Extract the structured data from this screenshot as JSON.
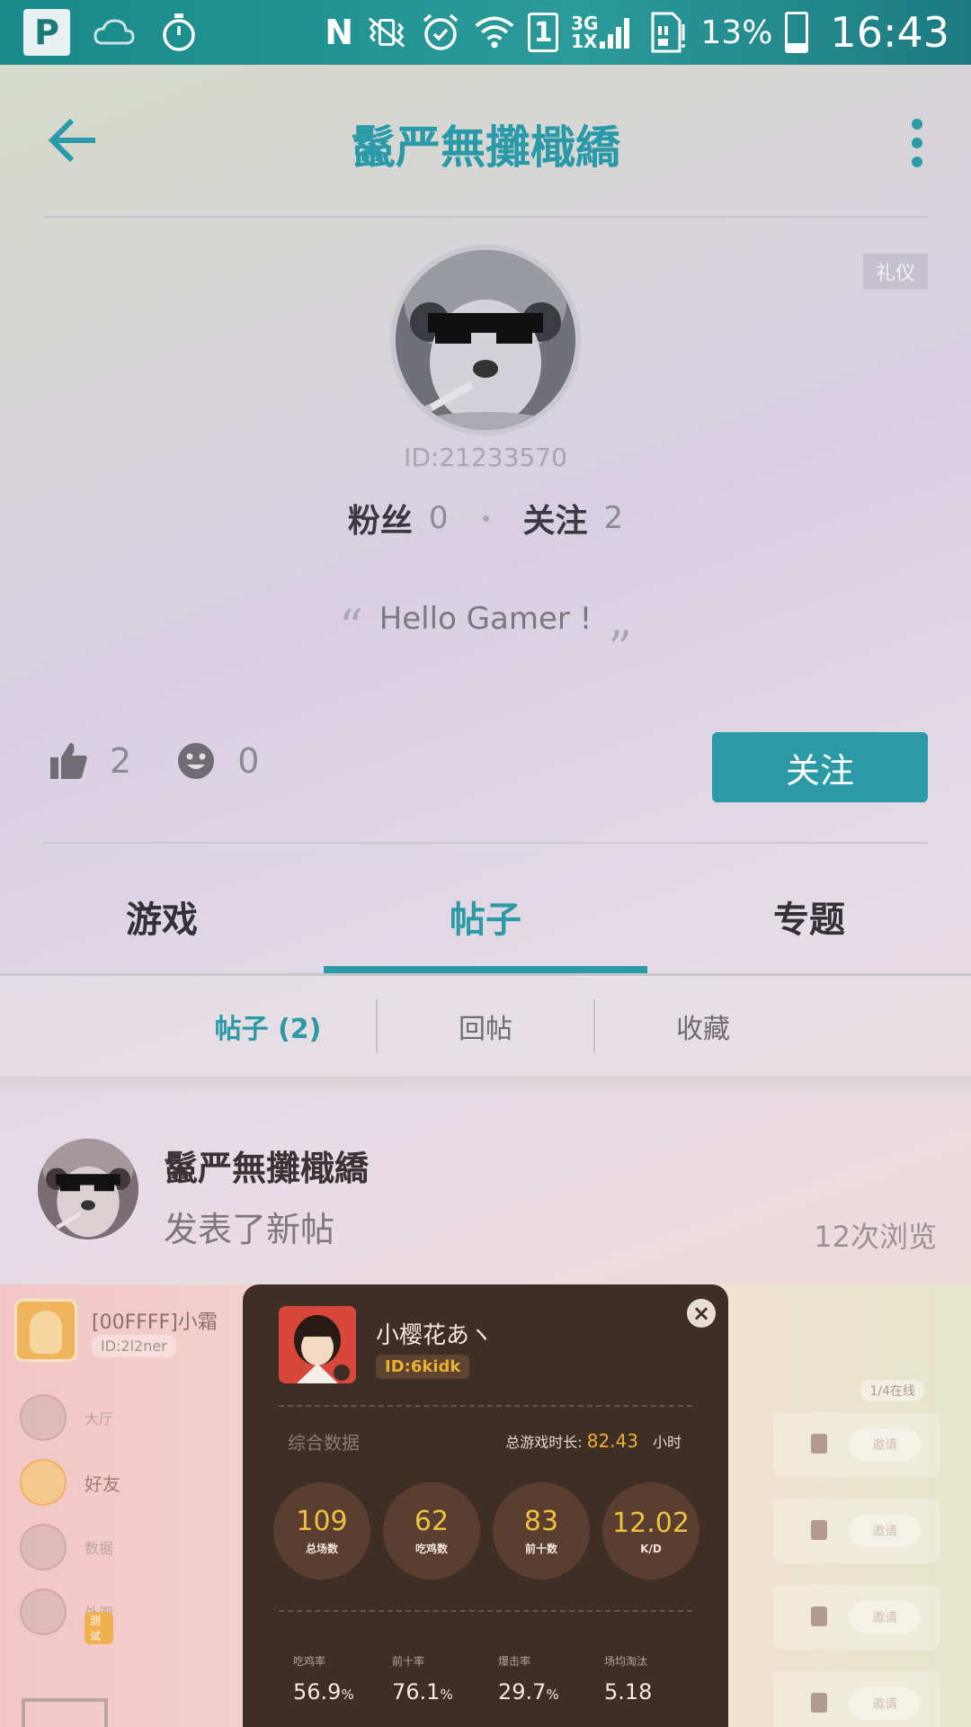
{
  "status_bar": {
    "app_icon_letter": "P",
    "nfc": "N",
    "sim": "1",
    "network_top": "3G",
    "network_bottom": "1X",
    "battery_percent": "13%",
    "time": "16:43"
  },
  "header": {
    "title": "鬣严無攤檝繑"
  },
  "profile": {
    "badge": "礼仪",
    "user_id": "ID:21233570",
    "followers_label": "粉丝",
    "followers_count": "0",
    "following_label": "关注",
    "following_count": "2",
    "motto": "Hello Gamer !",
    "likes": "2",
    "smiles": "0",
    "follow_button": "关注"
  },
  "tabs": [
    {
      "label": "游戏",
      "active": false
    },
    {
      "label": "帖子",
      "active": true
    },
    {
      "label": "专题",
      "active": false
    }
  ],
  "subtabs": [
    {
      "label": "帖子 (2)",
      "active": true
    },
    {
      "label": "回帖",
      "active": false
    },
    {
      "label": "收藏",
      "active": false
    }
  ],
  "post": {
    "author": "鬣严無攤檝繑",
    "action": "发表了新帖",
    "views": "12次浏览"
  },
  "embedded_screenshot": {
    "player_name": "[00FFFF]小霜",
    "player_id": "ID:2l2ner",
    "sidebar": [
      {
        "label": "大厅",
        "active": false
      },
      {
        "label": "好友",
        "active": true
      },
      {
        "label": "数据",
        "active": false
      },
      {
        "label": "外观",
        "active": false,
        "tag": "测试"
      }
    ],
    "online_status": "1/4在线",
    "invite_label": "邀请",
    "popup": {
      "name": "小樱花あヽ",
      "id": "ID:6kidk",
      "section_title": "综合数据",
      "total_time_label": "总游戏时长:",
      "total_time_value": "82.43",
      "total_time_unit": "小时",
      "stats": [
        {
          "value": "109",
          "label": "总场数"
        },
        {
          "value": "62",
          "label": "吃鸡数"
        },
        {
          "value": "83",
          "label": "前十数"
        },
        {
          "value": "12.02",
          "label": "K/D"
        }
      ],
      "rates": [
        {
          "label": "吃鸡率",
          "value": "56.9",
          "unit": "%"
        },
        {
          "label": "前十率",
          "value": "76.1",
          "unit": "%"
        },
        {
          "label": "爆击率",
          "value": "29.7",
          "unit": "%"
        },
        {
          "label": "场均淘汰",
          "value": "5.18",
          "unit": ""
        }
      ]
    }
  },
  "colors": {
    "accent": "#2b9aa6",
    "status_bar": "#198a8a"
  }
}
